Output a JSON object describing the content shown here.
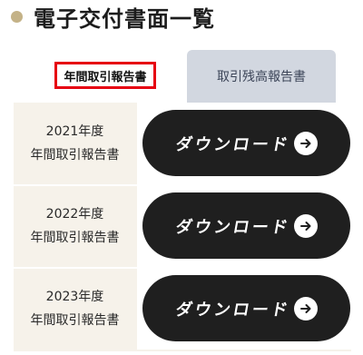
{
  "page": {
    "title": "電子交付書面一覧"
  },
  "tabs": [
    {
      "label": "年間取引報告書",
      "active": true
    },
    {
      "label": "取引残高報告書",
      "active": false
    }
  ],
  "rows": [
    {
      "year": "2021年度",
      "doc": "年間取引報告書",
      "button": "ダウンロード"
    },
    {
      "year": "2022年度",
      "doc": "年間取引報告書",
      "button": "ダウンロード"
    },
    {
      "year": "2023年度",
      "doc": "年間取引報告書",
      "button": "ダウンロード"
    }
  ],
  "colors": {
    "accent_dot": "#c4b287",
    "active_tab_border": "#e60012",
    "button_bg": "#1f1f1f",
    "row_bg": "#f6f2ea"
  },
  "icons": {
    "download_arrow": "arrow-right-circle-icon"
  }
}
